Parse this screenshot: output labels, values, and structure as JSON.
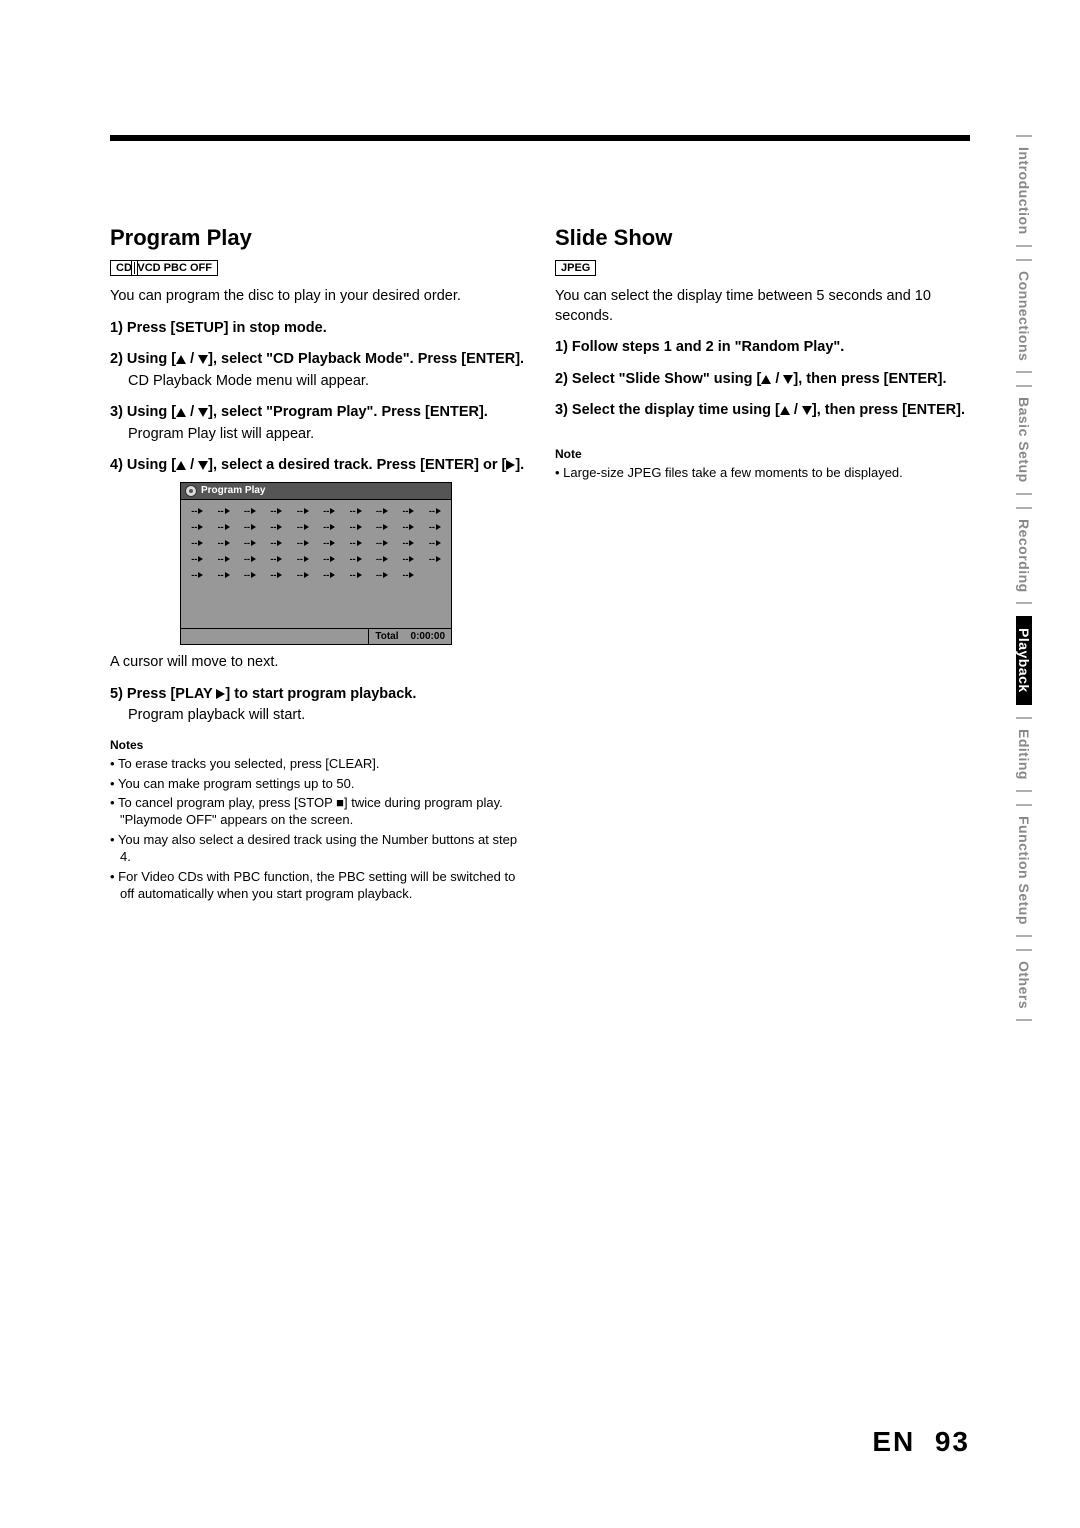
{
  "programPlay": {
    "heading": "Program Play",
    "badges": [
      "CD",
      "VCD PBC OFF"
    ],
    "intro": "You can program the disc to play in your desired order.",
    "step1": "1) Press [SETUP] in stop mode.",
    "step2a": "2) Using [",
    "step2b": "], select \"CD Playback Mode\". Press [ENTER].",
    "step2sub": "CD Playback Mode menu will appear.",
    "step3a": "3) Using [",
    "step3b": "], select \"Program Play\". Press [ENTER].",
    "step3sub": "Program Play list will appear.",
    "step4a": "4) Using [",
    "step4b": "], select a desired track. Press [ENTER] or [",
    "step4c": "].",
    "boxTitle": "Program Play",
    "boxTotal": "Total",
    "boxTime": "0:00:00",
    "cellText": "--",
    "afterBox": "A cursor will move to next.",
    "step5a": "5) Press [PLAY ",
    "step5b": "] to start program playback.",
    "step5sub": "Program playback will start.",
    "notesHeading": "Notes",
    "notes": [
      "To erase tracks you selected, press [CLEAR].",
      "You can make program settings up to 50.",
      "To cancel program play, press [STOP ■] twice during program play. \"Playmode OFF\" appears on the screen.",
      "You may also select a desired track using the Number buttons at step 4.",
      "For Video CDs with PBC function, the PBC setting will be switched to off automatically when you start program playback."
    ]
  },
  "slideShow": {
    "heading": "Slide Show",
    "badges": [
      "JPEG"
    ],
    "intro": "You can select the display time between 5 seconds and 10 seconds.",
    "step1": "1) Follow steps 1 and 2 in \"Random Play\".",
    "step2a": "2) Select \"Slide Show\" using [",
    "step2b": "], then press [ENTER].",
    "step3a": "3) Select the display time using [",
    "step3b": "], then press [ENTER].",
    "noteHeading": "Note",
    "note": "Large-size JPEG files take a few moments to be displayed."
  },
  "tabs": [
    {
      "label": "Introduction",
      "active": false
    },
    {
      "label": "Connections",
      "active": false
    },
    {
      "label": "Basic Setup",
      "active": false
    },
    {
      "label": "Recording",
      "active": false
    },
    {
      "label": "Playback",
      "active": true
    },
    {
      "label": "Editing",
      "active": false
    },
    {
      "label": "Function Setup",
      "active": false
    },
    {
      "label": "Others",
      "active": false
    }
  ],
  "pageLang": "EN",
  "pageNum": "93"
}
